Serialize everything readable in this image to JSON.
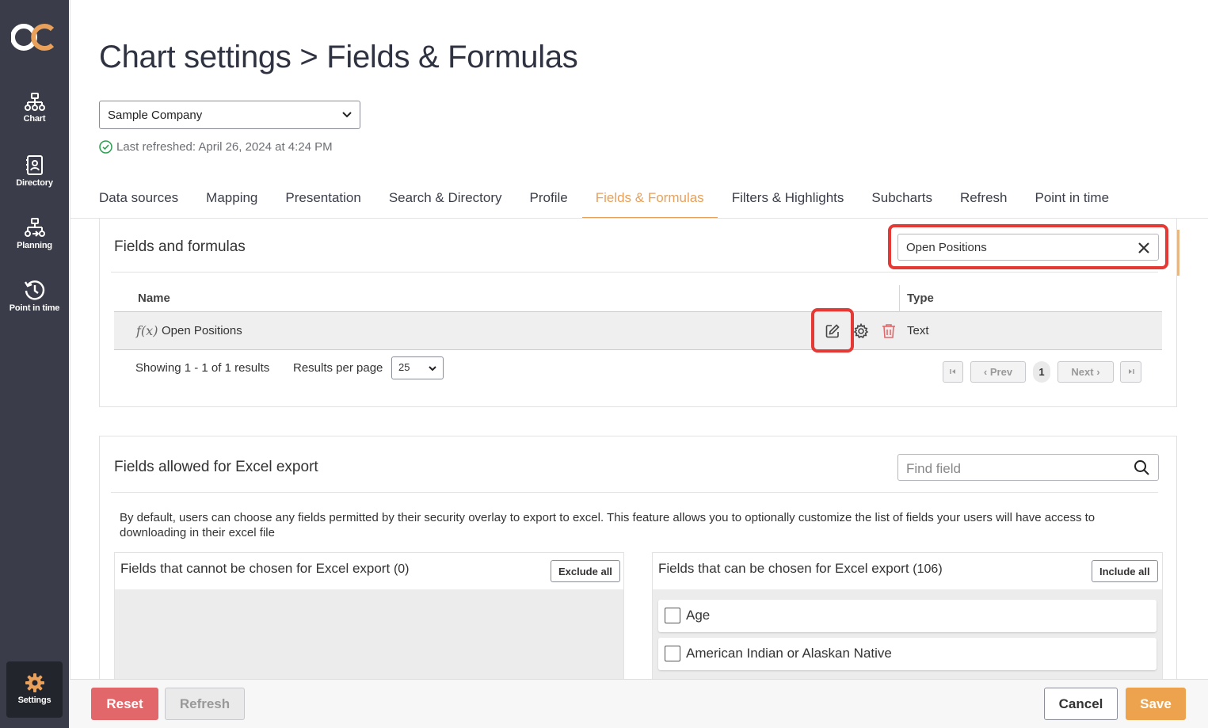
{
  "sidebar": {
    "logo_text": "OC",
    "items": [
      {
        "label": "Chart",
        "icon": "org-chart-icon"
      },
      {
        "label": "Directory",
        "icon": "directory-icon"
      },
      {
        "label": "Planning",
        "icon": "planning-icon"
      },
      {
        "label": "Point in time",
        "icon": "history-icon"
      }
    ],
    "settings_label": "Settings"
  },
  "header": {
    "title": "Chart settings > Fields & Formulas",
    "company_select": "Sample Company",
    "last_refreshed": "Last refreshed: April 26, 2024 at 4:24 PM"
  },
  "tabs": [
    {
      "label": "Data sources"
    },
    {
      "label": "Mapping"
    },
    {
      "label": "Presentation"
    },
    {
      "label": "Search & Directory"
    },
    {
      "label": "Profile"
    },
    {
      "label": "Fields & Formulas",
      "active": true
    },
    {
      "label": "Filters & Highlights"
    },
    {
      "label": "Subcharts"
    },
    {
      "label": "Refresh"
    },
    {
      "label": "Point in time"
    }
  ],
  "fields_panel": {
    "title": "Fields and formulas",
    "search_value": "Open Positions",
    "columns": {
      "name": "Name",
      "type": "Type"
    },
    "rows": [
      {
        "icon": "f(x)",
        "name": "Open Positions",
        "type": "Text"
      }
    ],
    "showing": "Showing 1 - 1 of 1 results",
    "results_per_page_label": "Results per page",
    "results_per_page": "25",
    "pager": {
      "prev": "Prev",
      "next": "Next",
      "current": "1"
    }
  },
  "excel_panel": {
    "title": "Fields allowed for Excel export",
    "search_placeholder": "Find field",
    "description": "By default, users can choose any fields permitted by their security overlay to export to excel. This feature allows you to optionally customize the list of fields your users will have access to downloading in their excel file",
    "excluded": {
      "title": "Fields that cannot be chosen for Excel export",
      "count": "(0)",
      "button": "Exclude all"
    },
    "included": {
      "title": "Fields that can be chosen for Excel export",
      "count": "(106)",
      "button": "Include all",
      "items": [
        {
          "label": "Age"
        },
        {
          "label": "American Indian or Alaskan Native"
        }
      ]
    }
  },
  "footer": {
    "reset": "Reset",
    "refresh": "Refresh",
    "cancel": "Cancel",
    "save": "Save"
  },
  "colors": {
    "accent": "#e8a05a",
    "sidebar": "#3a3d49",
    "danger": "#e2676a",
    "save": "#eda24d",
    "highlight": "#e53935"
  }
}
